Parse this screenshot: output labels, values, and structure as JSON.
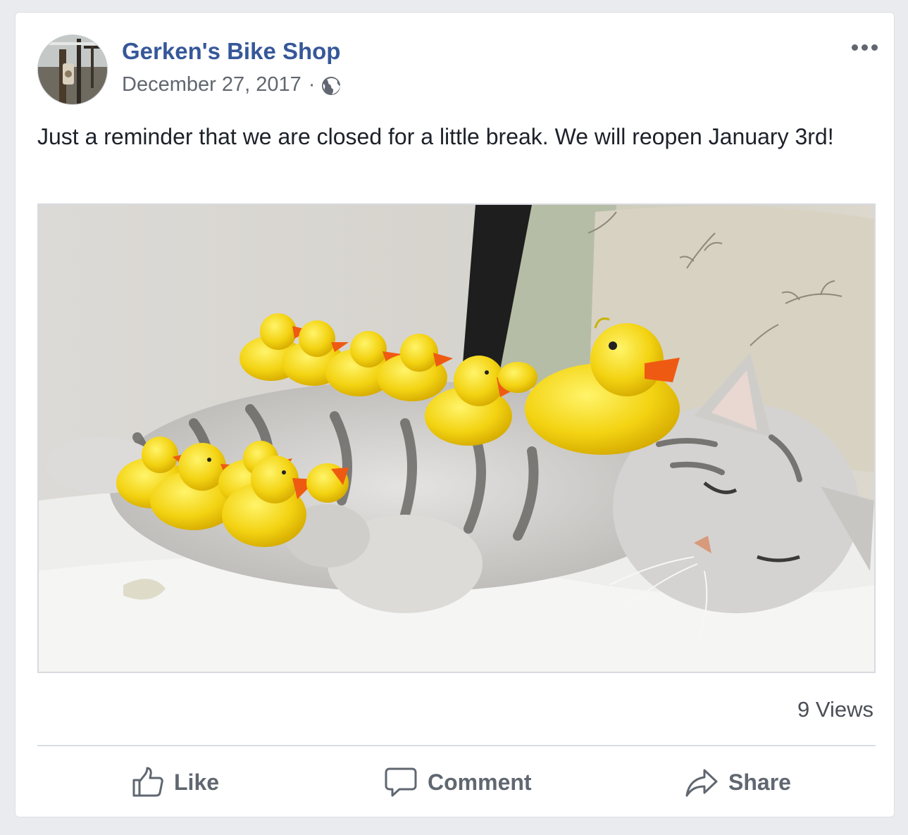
{
  "post": {
    "page_name": "Gerken's Bike Shop",
    "date": "December 27, 2017",
    "separator": "·",
    "privacy_icon": "globe-icon",
    "more_icon": "more-options-icon",
    "text": "Just a reminder that we are closed for a little break. We will reopen January 3rd!",
    "image_subject": "photo",
    "views": "9 Views"
  },
  "actions": {
    "like_label": "Like",
    "comment_label": "Comment",
    "share_label": "Share"
  },
  "colors": {
    "page_name": "#365899",
    "meta": "#616770",
    "body_text": "#1d2129",
    "action": "#606770",
    "background": "#e9ebee"
  }
}
